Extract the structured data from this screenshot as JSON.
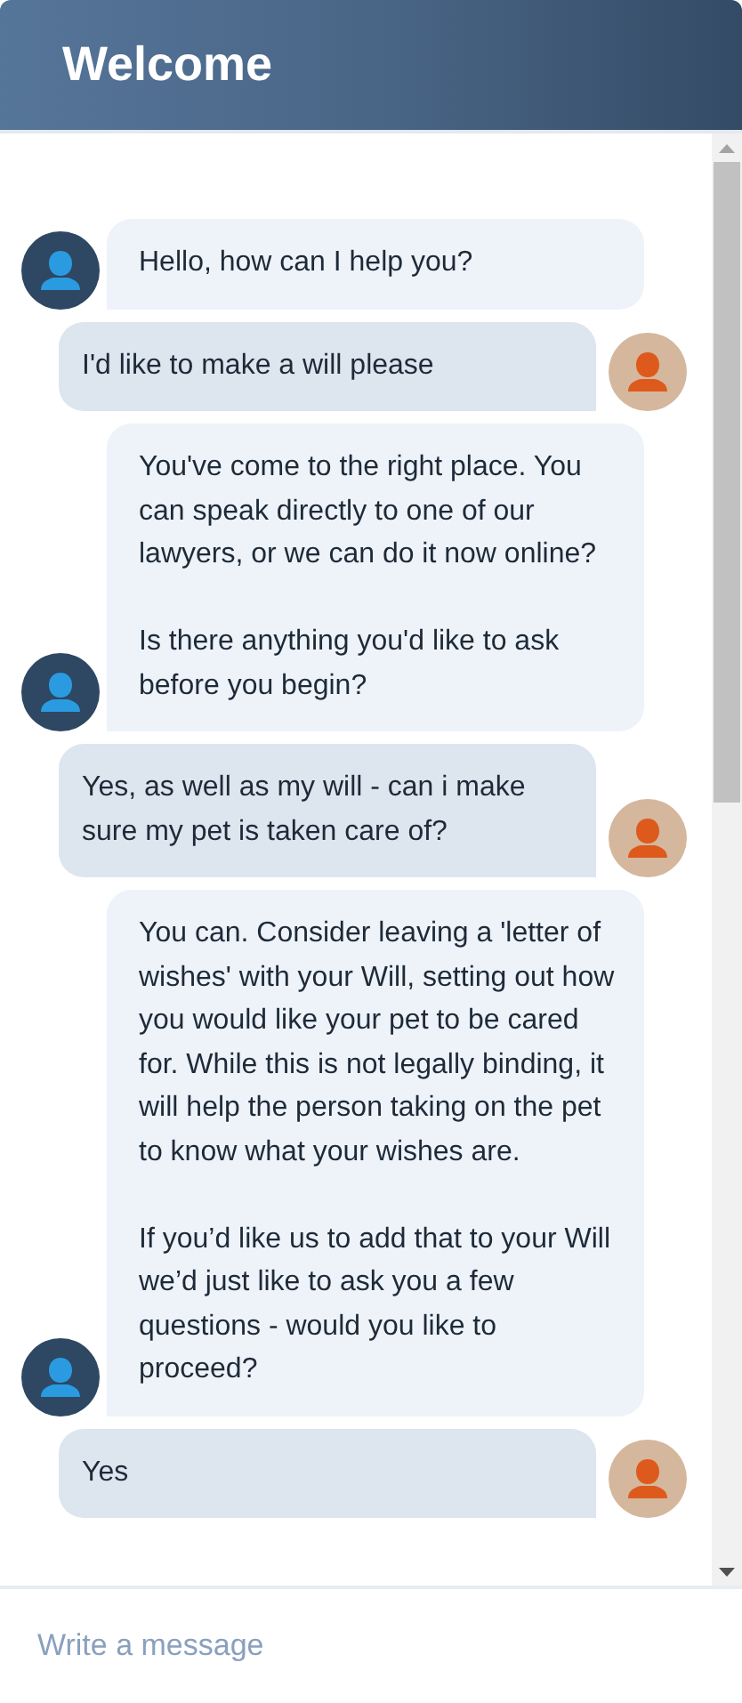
{
  "header": {
    "title": "Welcome"
  },
  "messages": [
    {
      "kind": "bot",
      "text": "Hello, how can I help you?"
    },
    {
      "kind": "user",
      "text": "I'd like to make a will please"
    },
    {
      "kind": "bot",
      "text": "You've come to the right place. You can speak directly to one of our lawyers, or we can do it now online?\n\nIs there anything you'd like to ask before you begin?"
    },
    {
      "kind": "user",
      "text": "Yes, as well as my will - can i make sure my pet is taken care of?"
    },
    {
      "kind": "bot",
      "text": "You can. Consider leaving a 'letter of wishes' with your Will, setting out how you would like your pet to be cared for. While this is not legally binding, it will help the person taking on the pet to know what your wishes are.\n\nIf you’d like us to add that to your Will we’d just like to ask you a few questions - would you like to proceed?"
    },
    {
      "kind": "user",
      "text": "Yes"
    }
  ],
  "composer": {
    "placeholder": "Write a message"
  }
}
